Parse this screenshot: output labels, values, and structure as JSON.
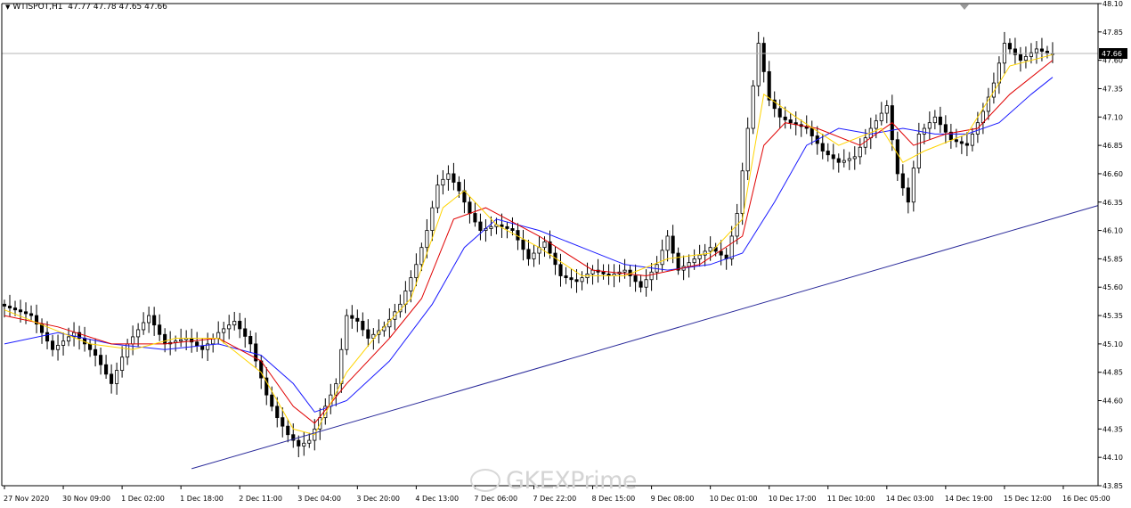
{
  "header": {
    "symbol": "WTISPOT,H1",
    "ohlc": "47.77 47.78 47.65 47.66"
  },
  "watermark": "GKEXPrime",
  "colors": {
    "candle": "#000000",
    "ma_fast": "#ffd400",
    "ma_mid": "#e00000",
    "ma_slow": "#1a1aff",
    "trendline": "#2a2a9a",
    "price_line": "#b4b4b4",
    "price_tag_bg": "#000000",
    "price_tag_text": "#ffffff"
  },
  "chart_data": {
    "type": "candlestick",
    "symbol": "WTISPOT",
    "timeframe": "H1",
    "current_price": 47.66,
    "ylim": [
      43.85,
      48.1
    ],
    "y_ticks": [
      48.1,
      47.85,
      47.6,
      47.35,
      47.1,
      46.85,
      46.6,
      46.35,
      46.1,
      45.85,
      45.6,
      45.35,
      45.1,
      44.85,
      44.6,
      44.35,
      44.1,
      43.85
    ],
    "x_ticks": [
      "27 Nov 2020",
      "30 Nov 09:00",
      "1 Dec 02:00",
      "1 Dec 18:00",
      "2 Dec 11:00",
      "3 Dec 04:00",
      "3 Dec 20:00",
      "4 Dec 13:00",
      "7 Dec 06:00",
      "7 Dec 22:00",
      "8 Dec 15:00",
      "9 Dec 08:00",
      "10 Dec 01:00",
      "10 Dec 17:00",
      "11 Dec 10:00",
      "14 Dec 03:00",
      "14 Dec 19:00",
      "15 Dec 12:00",
      "16 Dec 05:00"
    ],
    "close_path": [
      [
        0,
        45.45
      ],
      [
        6,
        45.35
      ],
      [
        10,
        45.05
      ],
      [
        14,
        45.2
      ],
      [
        18,
        45.0
      ],
      [
        21,
        44.75
      ],
      [
        24,
        45.1
      ],
      [
        28,
        45.35
      ],
      [
        31,
        45.1
      ],
      [
        35,
        45.15
      ],
      [
        38,
        45.05
      ],
      [
        41,
        45.2
      ],
      [
        44,
        45.3
      ],
      [
        47,
        45.1
      ],
      [
        50,
        44.65
      ],
      [
        52,
        44.45
      ],
      [
        54,
        44.3
      ],
      [
        56,
        44.2
      ],
      [
        58,
        44.25
      ],
      [
        61,
        44.55
      ],
      [
        63,
        44.75
      ],
      [
        65,
        45.35
      ],
      [
        67,
        45.3
      ],
      [
        69,
        45.15
      ],
      [
        72,
        45.25
      ],
      [
        75,
        45.45
      ],
      [
        78,
        45.8
      ],
      [
        80,
        46.1
      ],
      [
        82,
        46.5
      ],
      [
        84,
        46.6
      ],
      [
        86,
        46.45
      ],
      [
        88,
        46.25
      ],
      [
        90,
        46.1
      ],
      [
        93,
        46.15
      ],
      [
        96,
        46.1
      ],
      [
        99,
        45.85
      ],
      [
        102,
        46.0
      ],
      [
        105,
        45.7
      ],
      [
        108,
        45.65
      ],
      [
        111,
        45.75
      ],
      [
        114,
        45.7
      ],
      [
        117,
        45.75
      ],
      [
        120,
        45.6
      ],
      [
        123,
        45.8
      ],
      [
        125,
        46.05
      ],
      [
        127,
        45.75
      ],
      [
        130,
        45.85
      ],
      [
        133,
        45.95
      ],
      [
        136,
        45.85
      ],
      [
        138,
        46.25
      ],
      [
        140,
        47.0
      ],
      [
        142,
        47.75
      ],
      [
        144,
        47.25
      ],
      [
        146,
        47.1
      ],
      [
        148,
        47.05
      ],
      [
        151,
        47.0
      ],
      [
        154,
        46.8
      ],
      [
        157,
        46.7
      ],
      [
        160,
        46.75
      ],
      [
        163,
        47.0
      ],
      [
        166,
        47.2
      ],
      [
        168,
        46.6
      ],
      [
        170,
        46.35
      ],
      [
        172,
        46.95
      ],
      [
        175,
        47.1
      ],
      [
        178,
        46.9
      ],
      [
        181,
        46.85
      ],
      [
        184,
        47.15
      ],
      [
        186,
        47.4
      ],
      [
        188,
        47.75
      ],
      [
        191,
        47.6
      ],
      [
        194,
        47.7
      ],
      [
        196,
        47.66
      ]
    ],
    "ma_fast_path": [
      [
        0,
        45.4
      ],
      [
        8,
        45.25
      ],
      [
        16,
        45.1
      ],
      [
        24,
        45.05
      ],
      [
        32,
        45.15
      ],
      [
        40,
        45.15
      ],
      [
        48,
        44.85
      ],
      [
        54,
        44.35
      ],
      [
        58,
        44.3
      ],
      [
        64,
        44.85
      ],
      [
        70,
        45.2
      ],
      [
        76,
        45.5
      ],
      [
        82,
        46.3
      ],
      [
        86,
        46.45
      ],
      [
        92,
        46.15
      ],
      [
        100,
        45.95
      ],
      [
        108,
        45.7
      ],
      [
        116,
        45.7
      ],
      [
        124,
        45.85
      ],
      [
        132,
        45.9
      ],
      [
        138,
        46.2
      ],
      [
        142,
        47.3
      ],
      [
        148,
        47.1
      ],
      [
        156,
        46.85
      ],
      [
        164,
        47.0
      ],
      [
        168,
        46.7
      ],
      [
        172,
        46.8
      ],
      [
        180,
        46.95
      ],
      [
        188,
        47.55
      ],
      [
        196,
        47.65
      ]
    ],
    "ma_mid_path": [
      [
        0,
        45.35
      ],
      [
        10,
        45.25
      ],
      [
        20,
        45.1
      ],
      [
        30,
        45.1
      ],
      [
        40,
        45.15
      ],
      [
        48,
        44.95
      ],
      [
        54,
        44.55
      ],
      [
        58,
        44.4
      ],
      [
        64,
        44.75
      ],
      [
        72,
        45.15
      ],
      [
        78,
        45.5
      ],
      [
        84,
        46.2
      ],
      [
        90,
        46.3
      ],
      [
        100,
        46.05
      ],
      [
        110,
        45.75
      ],
      [
        120,
        45.7
      ],
      [
        130,
        45.8
      ],
      [
        138,
        46.05
      ],
      [
        142,
        46.85
      ],
      [
        146,
        47.05
      ],
      [
        152,
        47.0
      ],
      [
        160,
        46.85
      ],
      [
        166,
        47.05
      ],
      [
        170,
        46.85
      ],
      [
        176,
        46.95
      ],
      [
        182,
        47.0
      ],
      [
        188,
        47.3
      ],
      [
        196,
        47.6
      ]
    ],
    "ma_slow_path": [
      [
        0,
        45.1
      ],
      [
        10,
        45.2
      ],
      [
        20,
        45.1
      ],
      [
        30,
        45.05
      ],
      [
        40,
        45.1
      ],
      [
        48,
        45.0
      ],
      [
        54,
        44.75
      ],
      [
        58,
        44.5
      ],
      [
        64,
        44.6
      ],
      [
        72,
        44.95
      ],
      [
        80,
        45.45
      ],
      [
        86,
        45.95
      ],
      [
        92,
        46.2
      ],
      [
        100,
        46.1
      ],
      [
        108,
        45.95
      ],
      [
        116,
        45.8
      ],
      [
        124,
        45.75
      ],
      [
        132,
        45.8
      ],
      [
        138,
        45.9
      ],
      [
        144,
        46.35
      ],
      [
        150,
        46.85
      ],
      [
        156,
        47.0
      ],
      [
        162,
        46.95
      ],
      [
        168,
        47.0
      ],
      [
        174,
        46.95
      ],
      [
        180,
        46.95
      ],
      [
        186,
        47.05
      ],
      [
        192,
        47.3
      ],
      [
        196,
        47.45
      ]
    ],
    "trendline": [
      [
        35,
        44.0
      ],
      [
        204,
        46.32
      ]
    ]
  }
}
